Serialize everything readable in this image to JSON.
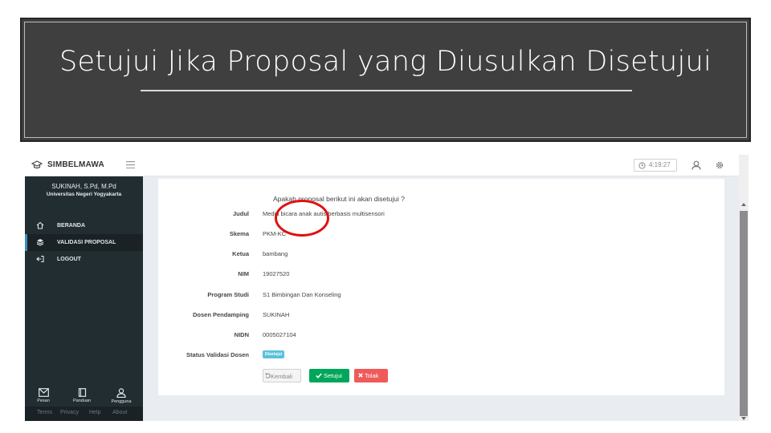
{
  "slide": {
    "title": "Setujui Jika Proposal yang Diusulkan Disetujui"
  },
  "app": {
    "brand": "SIMBELMAWA",
    "clock": "4:19:27"
  },
  "user": {
    "name": "SUKINAH, S.Pd, M.Pd",
    "university": "Universitas Negeri Yogyakarta"
  },
  "sidebar": {
    "items": [
      {
        "label": "BERANDA",
        "icon": "home-icon"
      },
      {
        "label": "VALIDASI PROPOSAL",
        "icon": "layers-icon"
      },
      {
        "label": "LOGOUT",
        "icon": "logout-icon"
      }
    ],
    "bottom": [
      {
        "label": "Pesan",
        "icon": "envelope-icon"
      },
      {
        "label": "Panduan",
        "icon": "book-icon"
      },
      {
        "label": "Pengguna",
        "icon": "user-icon"
      }
    ],
    "links": [
      "Terms",
      "Privacy",
      "Help",
      "About"
    ]
  },
  "form": {
    "question": "Apakah proposal berikut ini akan disetujui ?",
    "fields": [
      {
        "label": "Judul",
        "value": "Media bicara anak autis berbasis multisensori"
      },
      {
        "label": "Skema",
        "value": "PKM-KC"
      },
      {
        "label": "Ketua",
        "value": "bambang"
      },
      {
        "label": "NIM",
        "value": "19027520"
      },
      {
        "label": "Program Studi",
        "value": "S1 Bimbingan Dan Konseling"
      },
      {
        "label": "Dosen Pendamping",
        "value": "SUKINAH"
      },
      {
        "label": "NIDN",
        "value": "0005027104"
      }
    ],
    "status_label": "Status Validasi Dosen",
    "status_badge": "Disetujui",
    "buttons": {
      "back": "Kembali",
      "approve": "Setujui",
      "reject": "Tolak"
    }
  },
  "colors": {
    "sidebar_bg": "#222d32",
    "approve": "#00a65a",
    "reject": "#ef5a5a",
    "badge": "#5bc0de",
    "highlight": "#e01010"
  }
}
